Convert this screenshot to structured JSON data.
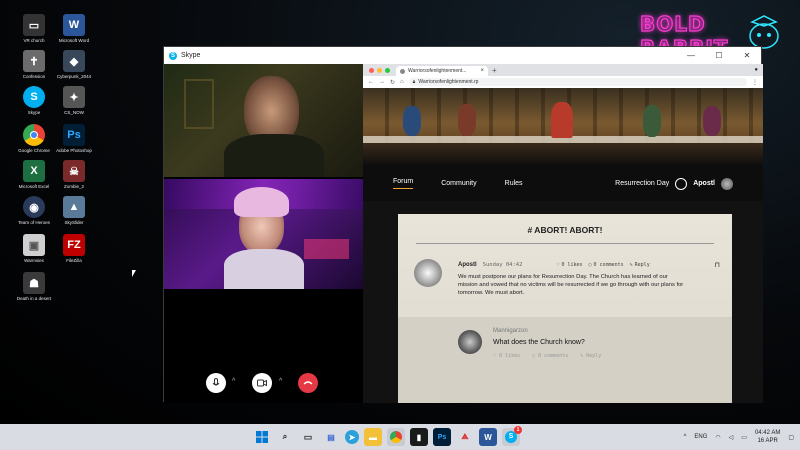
{
  "desktop": {
    "neon_text": "BOLD\nRABBIT",
    "icons": [
      {
        "label": "VR church",
        "icon": "vr-headset-icon",
        "color": "#444"
      },
      {
        "label": "Microsoft Word",
        "icon": "word-icon",
        "color": "#2b579a",
        "glyph": "W"
      },
      {
        "label": "Confession",
        "icon": "cross-icon",
        "color": "#6b6b6b",
        "glyph": "✝"
      },
      {
        "label": "Cyberpunk_2044",
        "icon": "cyberpunk-icon",
        "color": "#39475a"
      },
      {
        "label": "Skype",
        "icon": "skype-icon",
        "color": "#00aff0",
        "glyph": "S"
      },
      {
        "label": "CS_NOW",
        "icon": "cs-icon",
        "color": "#555"
      },
      {
        "label": "Google Chrome",
        "icon": "chrome-icon",
        "color": "#ea4335"
      },
      {
        "label": "Adobe Photoshop",
        "icon": "photoshop-icon",
        "color": "#001e36",
        "glyph": "Ps"
      },
      {
        "label": "Microsoft Excel",
        "icon": "excel-icon",
        "color": "#1d6f42",
        "glyph": "X"
      },
      {
        "label": "Zombie_2",
        "icon": "zombie-icon",
        "color": "#7a2a2a"
      },
      {
        "label": "Team of Heroes",
        "icon": "heroes-icon",
        "color": "#2a3a5a"
      },
      {
        "label": "SkySlider",
        "icon": "skyslider-icon",
        "color": "#5a7a9a"
      },
      {
        "label": "Warmsies",
        "icon": "cube-icon",
        "color": "#cfcfcf"
      },
      {
        "label": "FileZilla",
        "icon": "filezilla-icon",
        "color": "#bf0000",
        "glyph": "FZ"
      },
      {
        "label": "Death in a desert",
        "icon": "desert-icon",
        "color": "#3a3a3a"
      }
    ]
  },
  "skype": {
    "title": "Skype",
    "controls": [
      "—",
      "☐",
      "✕"
    ]
  },
  "browser": {
    "tab_title": "Warriorsofenlightenment...",
    "url": "Warriorsofenlightenment.rp"
  },
  "site": {
    "nav": [
      "Forum",
      "Community",
      "Rules"
    ],
    "nav_right_label": "Resurrection Day",
    "user": "Apostl",
    "thread_title": "# ABORT! ABORT!",
    "post": {
      "author": "Apostl",
      "timestamp": "Sunday 04:42",
      "likes": "0 likes",
      "comments": "0 comments",
      "reply": "Reply",
      "body": "We must postpone our plans for Resurrection Day. The Church has learned of our mission and vowed that no victims will be resurrected if we go through with our plans for tomorrow. We must abort."
    },
    "reply": {
      "author": "Mannigarzon",
      "text": "What does the Church know?",
      "likes": "0 likes",
      "comments": "0 comments",
      "reply": "Reply"
    }
  },
  "taskbar": {
    "language": "ENG",
    "time": "04:42 AM",
    "date": "16 APR",
    "skype_badge": "1"
  }
}
